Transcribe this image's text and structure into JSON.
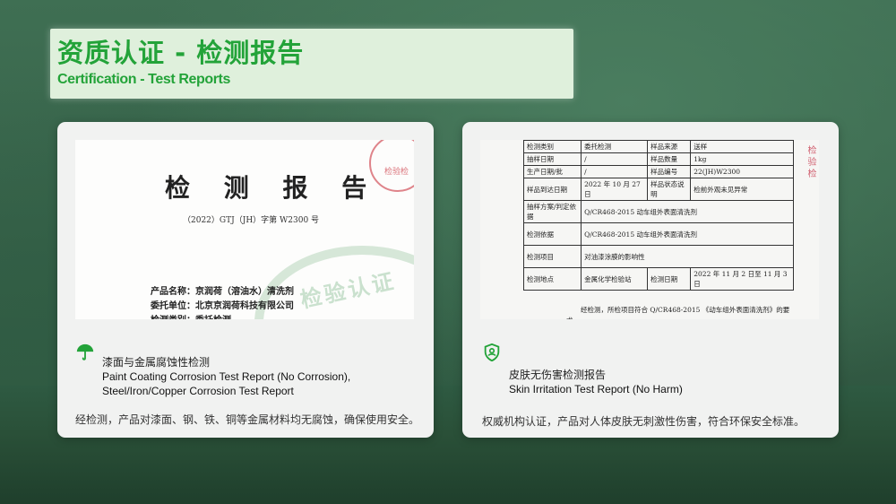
{
  "header": {
    "title_cn": "资质认证 - 检测报告",
    "title_en": "Certification - Test Reports"
  },
  "colors": {
    "accent": "#23a339",
    "title_box": "#dff0dc",
    "card_bg": "#f1f2f1"
  },
  "cards": [
    {
      "icon": "umbrella-icon",
      "title": "漆面与金属腐蚀性检测",
      "en_line1": "Paint Coating Corrosion Test Report (No Corrosion),",
      "en_line2": "Steel/Iron/Copper Corrosion Test Report",
      "description": "经检测，产品对漆面、钢、铁、铜等金属材料均无腐蚀，确保使用安全。",
      "report": {
        "heading": "检 测 报 告",
        "number": "（2022）GTJ（JH）字第 W2300 号",
        "lines": [
          "产品名称：京润荷（溶油水）清洗剂",
          "委托单位：北京京润荷科技有限公司",
          "检测类别：委托检测"
        ],
        "watermark": "检验认证",
        "stamp": "检验检"
      }
    },
    {
      "icon": "user-shield-icon",
      "title": "皮肤无伤害检测报告",
      "en_line1": "Skin Irritation Test Report (No Harm)",
      "description": "权威机构认证，产品对人体皮肤无刺激性伤害，符合环保安全标准。",
      "report": {
        "rows": [
          [
            "检测类别",
            "委托检测",
            "样品来源",
            "送样"
          ],
          [
            "抽样日期",
            "/",
            "样品数量",
            "1kg"
          ],
          [
            "生产日期/批",
            "/",
            "样品编号",
            "22(JH)W2300"
          ],
          [
            "样品到达日期",
            "2022 年 10 月 27 日",
            "样品状态说明",
            "检前外观未见异常"
          ]
        ],
        "wide_rows": [
          [
            "抽样方案/判定依据",
            "Q/CR468-2015 动车组外表面清洗剂"
          ],
          [
            "检测依据",
            "Q/CR468-2015 动车组外表面清洗剂"
          ],
          [
            "检测项目",
            "对油漆涂膜的影响性"
          ]
        ],
        "site_row": [
          "检测地点",
          "金属化学检验站",
          "检测日期",
          "2022 年 11 月 2 日至 11 月 3 日"
        ],
        "footer_1": "经检测，所检项目符合 Q/CR468-2015 《动车组外表面清洗剂》的要",
        "footer_2": "求。",
        "side_mark": "检验检"
      }
    }
  ]
}
